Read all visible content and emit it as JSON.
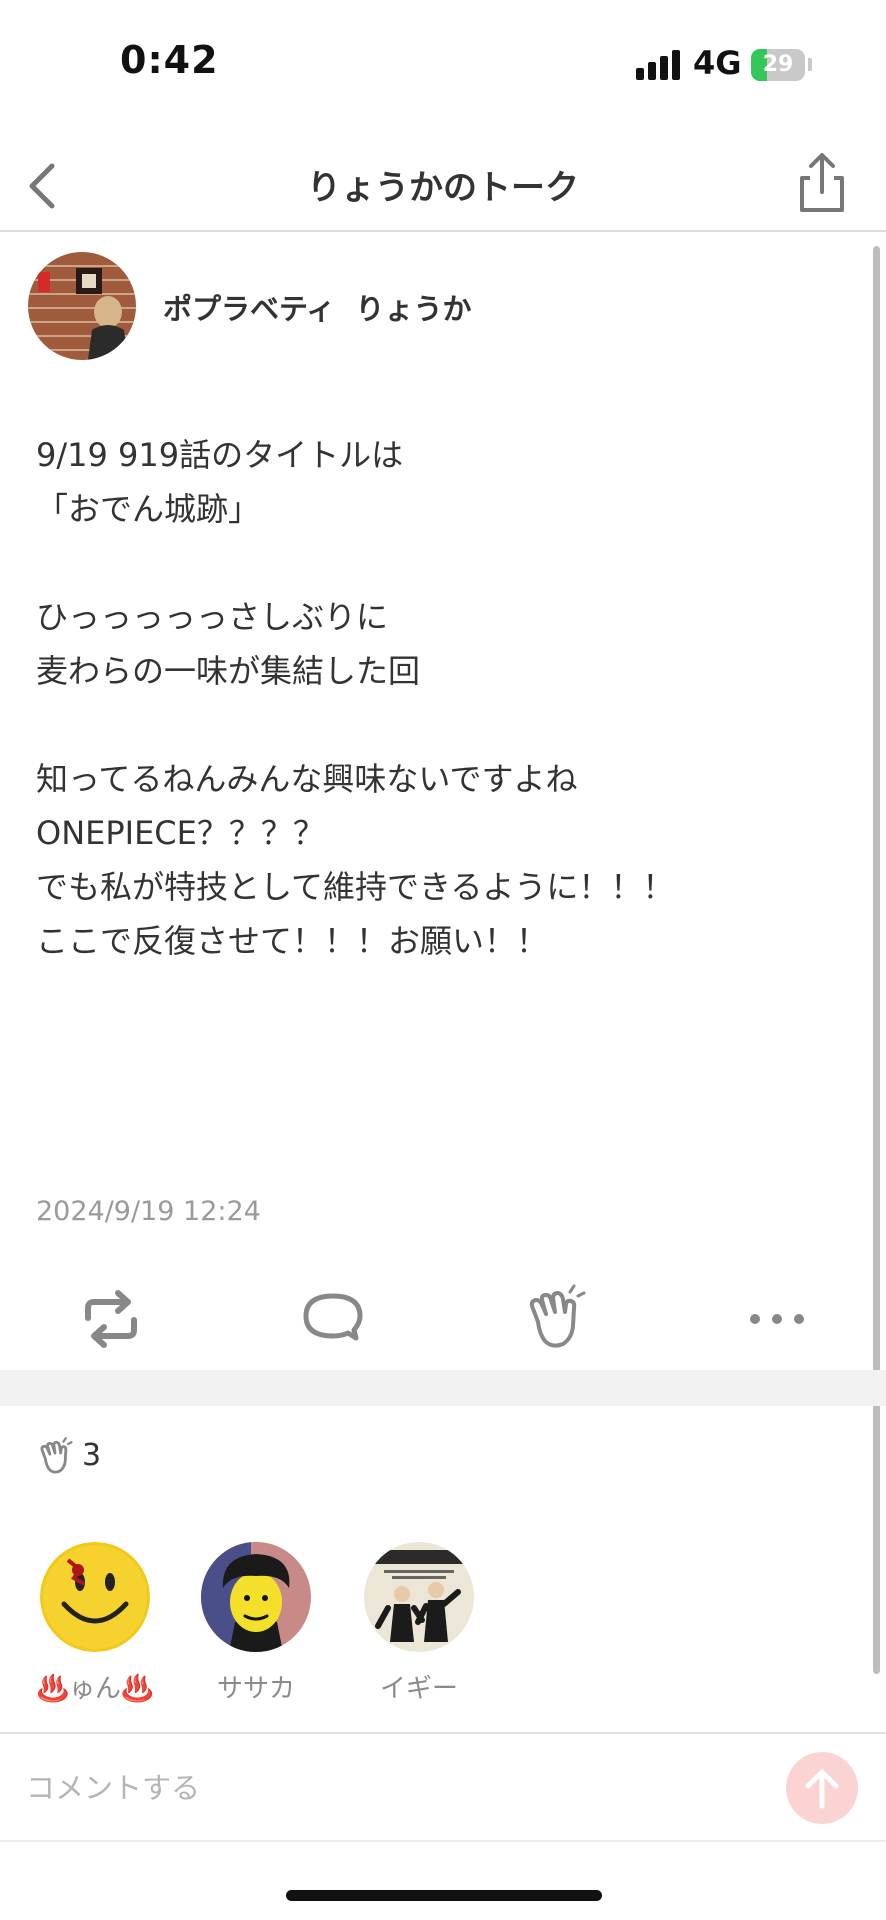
{
  "status_bar": {
    "time": "0:42",
    "network": "4G",
    "battery_level": "29",
    "battery_percent": 29,
    "battery_color": "#34c759"
  },
  "header": {
    "title": "りょうかのトーク",
    "back_icon": "chevron-left-icon",
    "share_icon": "share-icon"
  },
  "post": {
    "author_name": "ポプラベティ  りょうか",
    "lines": [
      "9/19 919話のタイトルは",
      "「おでん城跡」",
      "",
      "ひっっっっっさしぶりに",
      "麦わらの一味が集結した回",
      "",
      "知ってるねんみんな興味ないですよね",
      "ONEPIECE？？？？",
      "でも私が特技として維持できるように！！！",
      "ここで反復させて！！！お願い！！"
    ],
    "timestamp": "2024/9/19 12:24"
  },
  "actions": {
    "repost_icon": "repost-icon",
    "comment_icon": "comment-icon",
    "clap_icon": "clap-icon",
    "more_icon": "more-icon"
  },
  "likes": {
    "count": "3",
    "users": [
      {
        "name": "♨️ゅん♨️"
      },
      {
        "name": "ササカ"
      },
      {
        "name": "イギー"
      }
    ]
  },
  "comment": {
    "placeholder": "コメントする",
    "send_icon": "arrow-up-icon",
    "send_color": "#fcd3d3"
  }
}
